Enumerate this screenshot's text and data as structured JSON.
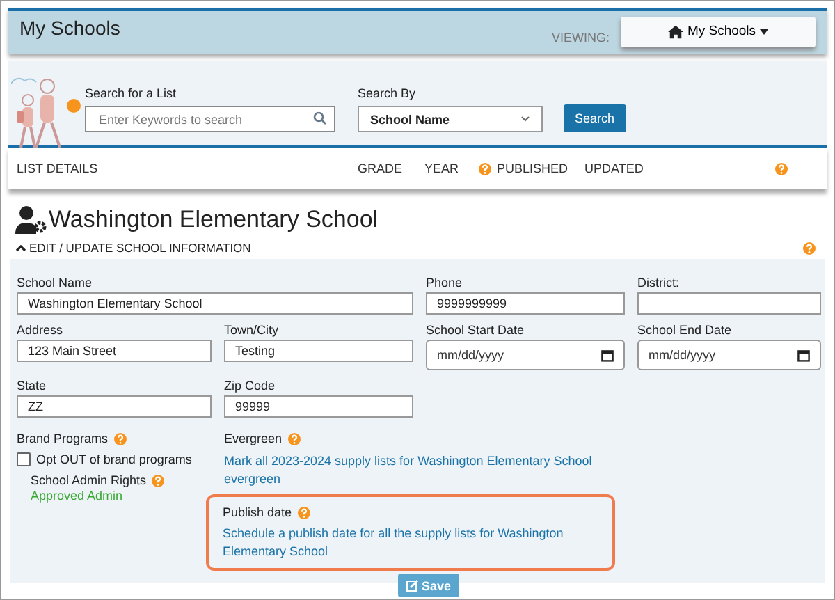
{
  "header": {
    "title": "My Schools",
    "viewing_label": "VIEWING:",
    "viewing_button": "My Schools"
  },
  "search": {
    "label": "Search for a List",
    "placeholder": "Enter Keywords to search",
    "by_label": "Search By",
    "by_value": "School Name",
    "button": "Search"
  },
  "list_columns": [
    "LIST DETAILS",
    "GRADE",
    "YEAR",
    "PUBLISHED",
    "UPDATED"
  ],
  "school": {
    "name": "Washington Elementary School",
    "section_toggle": "EDIT / UPDATE SCHOOL INFORMATION",
    "expanded": true
  },
  "fields": [
    {
      "label": "School Name",
      "value": "Washington Elementary School",
      "kind": "text"
    },
    {
      "label": "Phone",
      "value": "9999999999",
      "kind": "text"
    },
    {
      "label": "District:",
      "kind": "text"
    },
    {
      "label": "Address",
      "value": "123 Main Street",
      "kind": "text"
    },
    {
      "label": "Town/City",
      "value": "Testing",
      "kind": "text"
    },
    {
      "label": "School Start Date",
      "value": "mm/dd/yyyy",
      "kind": "date"
    },
    {
      "label": "School End Date",
      "value": "mm/dd/yyyy",
      "kind": "date"
    },
    {
      "label": "State",
      "value": "ZZ",
      "kind": "text"
    },
    {
      "label": "Zip Code",
      "value": "99999",
      "kind": "text"
    }
  ],
  "brand_programs": {
    "label": "Brand Programs",
    "checkbox_label": "Opt OUT of brand programs",
    "checked": false
  },
  "admin_rights": {
    "label": "School Admin Rights",
    "status": "Approved Admin"
  },
  "evergreen": {
    "label": "Evergreen",
    "link": "Mark all 2023-2024 supply lists for Washington Elementary School evergreen"
  },
  "publish_date": {
    "label": "Publish date",
    "link": "Schedule a publish date for all the supply lists for Washington Elementary School"
  },
  "save_button": "Save"
}
